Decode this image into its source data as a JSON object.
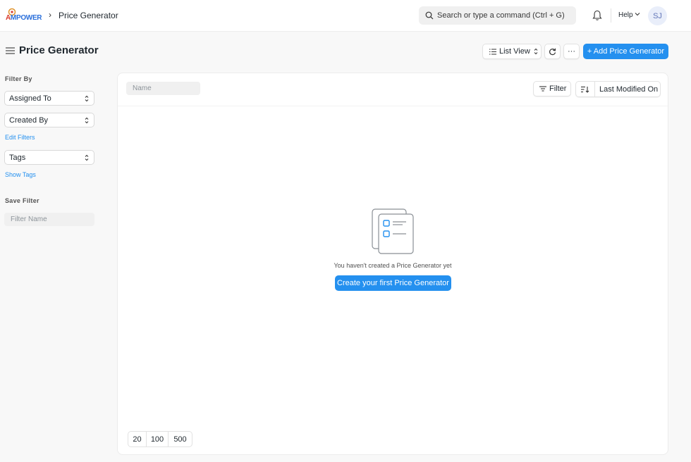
{
  "navbar": {
    "logo_text_a": "A",
    "logo_text_rest": "MPOWER",
    "breadcrumb": "Price Generator",
    "search_text": "Search or type a command (Ctrl + G)",
    "help_label": "Help",
    "avatar_initials": "SJ"
  },
  "header": {
    "title": "Price Generator",
    "list_view_label": "List View",
    "more_label": "···",
    "add_label": "+ Add Price Generator"
  },
  "sidebar": {
    "filter_by_heading": "Filter By",
    "assigned_to": "Assigned To",
    "created_by": "Created By",
    "edit_filters": "Edit Filters",
    "tags": "Tags",
    "show_tags": "Show Tags",
    "save_filter_heading": "Save Filter",
    "filter_name_placeholder": "Filter Name"
  },
  "main": {
    "name_placeholder": "Name",
    "filter_label": "Filter",
    "sort_label": "Last Modified On",
    "empty_message": "You haven't created a Price Generator yet",
    "create_label": "Create your first Price Generator",
    "page_sizes": [
      "20",
      "100",
      "500"
    ]
  },
  "colors": {
    "primary": "#2490ef",
    "background": "#f8f8f8",
    "text": "#1f272e"
  },
  "icons": [
    "search-icon",
    "bell-icon",
    "chevron-down-icon",
    "hamburger-icon",
    "list-icon",
    "refresh-icon",
    "filter-icon",
    "sort-icon",
    "empty-list-illustration"
  ]
}
